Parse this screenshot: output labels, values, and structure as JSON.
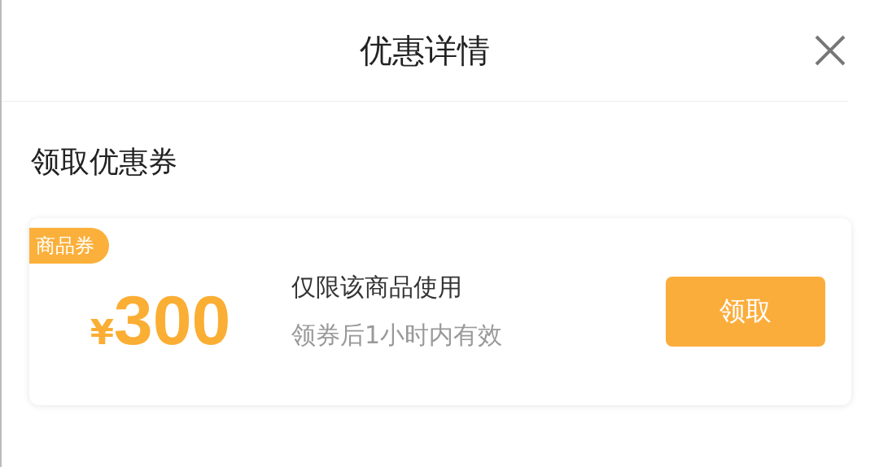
{
  "header": {
    "title": "优惠详情"
  },
  "section": {
    "title": "领取优惠券"
  },
  "coupon": {
    "tag": "商品券",
    "currency": "¥",
    "amount": "300",
    "condition": "仅限该商品使用",
    "validity": "领券后1小时内有效",
    "button": "领取"
  }
}
